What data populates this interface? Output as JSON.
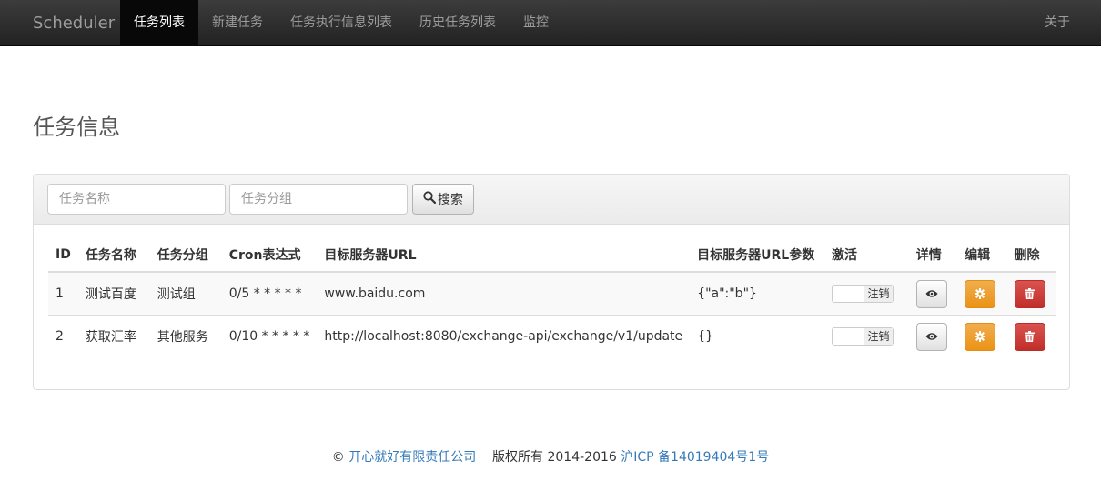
{
  "navbar": {
    "brand": "Scheduler",
    "items": [
      "任务列表",
      "新建任务",
      "任务执行信息列表",
      "历史任务列表",
      "监控"
    ],
    "right": "关于"
  },
  "page_title": "任务信息",
  "search": {
    "name_placeholder": "任务名称",
    "group_placeholder": "任务分组",
    "button_label": "搜索"
  },
  "table": {
    "headers": [
      "ID",
      "任务名称",
      "任务分组",
      "Cron表达式",
      "目标服务器URL",
      "目标服务器URL参数",
      "激活",
      "详情",
      "编辑",
      "删除"
    ],
    "rows": [
      {
        "id": "1",
        "name": "测试百度",
        "group": "测试组",
        "cron": "0/5 * * * * *",
        "url": "www.baidu.com",
        "params": "{\"a\":\"b\"}",
        "toggle": "注销"
      },
      {
        "id": "2",
        "name": "获取汇率",
        "group": "其他服务",
        "cron": "0/10 * * * * *",
        "url": "http://localhost:8080/exchange-api/exchange/v1/update",
        "params": "{}",
        "toggle": "注销"
      }
    ]
  },
  "footer": {
    "copyright_symbol": "©",
    "company": "开心就好有限责任公司",
    "rights": "版权所有 2014-2016",
    "icp": "沪ICP 备14019404号1号"
  },
  "colors": {
    "link": "#337ab7",
    "warning": "#f0ad4e",
    "danger": "#d9534f",
    "navbar": "#222222"
  }
}
